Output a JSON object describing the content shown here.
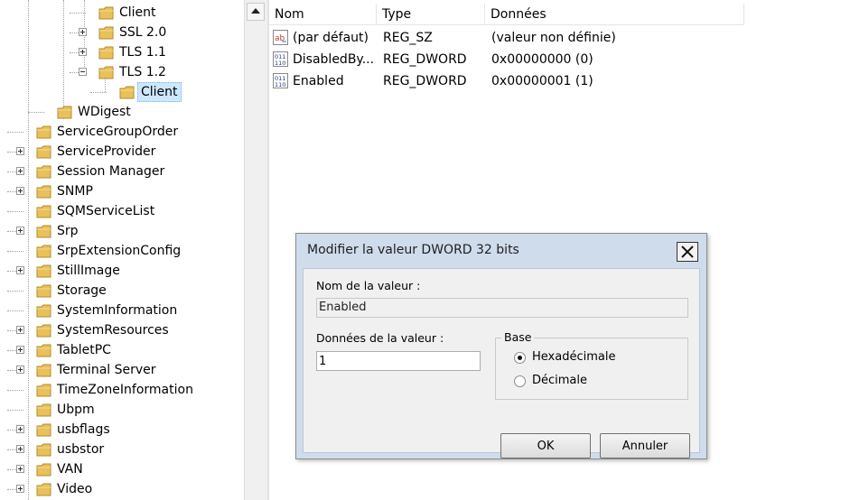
{
  "tree": {
    "items": [
      {
        "label": "Client",
        "level": 3,
        "expander": "none",
        "selected": false
      },
      {
        "label": "SSL 2.0",
        "level": 3,
        "expander": "plus",
        "selected": false
      },
      {
        "label": "TLS 1.1",
        "level": 3,
        "expander": "plus",
        "selected": false
      },
      {
        "label": "TLS 1.2",
        "level": 3,
        "expander": "minus",
        "selected": false
      },
      {
        "label": "Client",
        "level": 4,
        "expander": "none",
        "selected": true
      },
      {
        "label": "WDigest",
        "level": 2,
        "expander": "none",
        "selected": false
      },
      {
        "label": "ServiceGroupOrder",
        "level": 1,
        "expander": "none",
        "selected": false
      },
      {
        "label": "ServiceProvider",
        "level": 1,
        "expander": "plus",
        "selected": false
      },
      {
        "label": "Session Manager",
        "level": 1,
        "expander": "plus",
        "selected": false
      },
      {
        "label": "SNMP",
        "level": 1,
        "expander": "plus",
        "selected": false
      },
      {
        "label": "SQMServiceList",
        "level": 1,
        "expander": "none",
        "selected": false
      },
      {
        "label": "Srp",
        "level": 1,
        "expander": "plus",
        "selected": false
      },
      {
        "label": "SrpExtensionConfig",
        "level": 1,
        "expander": "none",
        "selected": false
      },
      {
        "label": "StillImage",
        "level": 1,
        "expander": "plus",
        "selected": false
      },
      {
        "label": "Storage",
        "level": 1,
        "expander": "none",
        "selected": false
      },
      {
        "label": "SystemInformation",
        "level": 1,
        "expander": "none",
        "selected": false
      },
      {
        "label": "SystemResources",
        "level": 1,
        "expander": "plus",
        "selected": false
      },
      {
        "label": "TabletPC",
        "level": 1,
        "expander": "plus",
        "selected": false
      },
      {
        "label": "Terminal Server",
        "level": 1,
        "expander": "plus",
        "selected": false
      },
      {
        "label": "TimeZoneInformation",
        "level": 1,
        "expander": "none",
        "selected": false
      },
      {
        "label": "Ubpm",
        "level": 1,
        "expander": "none",
        "selected": false
      },
      {
        "label": "usbflags",
        "level": 1,
        "expander": "plus",
        "selected": false
      },
      {
        "label": "usbstor",
        "level": 1,
        "expander": "plus",
        "selected": false
      },
      {
        "label": "VAN",
        "level": 1,
        "expander": "plus",
        "selected": false
      },
      {
        "label": "Video",
        "level": 1,
        "expander": "plus",
        "selected": false
      }
    ]
  },
  "list": {
    "columns": [
      "Nom",
      "Type",
      "Données"
    ],
    "rows": [
      {
        "name": "(par défaut)",
        "type": "REG_SZ",
        "data": "(valeur non définie)",
        "icon": "string-value-icon"
      },
      {
        "name": "DisabledBy...",
        "type": "REG_DWORD",
        "data": "0x00000000 (0)",
        "icon": "binary-value-icon"
      },
      {
        "name": "Enabled",
        "type": "REG_DWORD",
        "data": "0x00000001 (1)",
        "icon": "binary-value-icon"
      }
    ]
  },
  "dialog": {
    "title": "Modifier la valeur DWORD 32 bits",
    "value_name_label": "Nom de la valeur :",
    "value_name": "Enabled",
    "value_data_label": "Données de la valeur :",
    "value_data": "1",
    "base_label": "Base",
    "base_options": [
      {
        "label": "Hexadécimale",
        "selected": true
      },
      {
        "label": "Décimale",
        "selected": false
      }
    ],
    "ok_label": "OK",
    "cancel_label": "Annuler"
  },
  "colors": {
    "dialog_title_bg": "#cfdcec",
    "selection_bg": "#cce8ff",
    "folder": "#e8c15a"
  }
}
